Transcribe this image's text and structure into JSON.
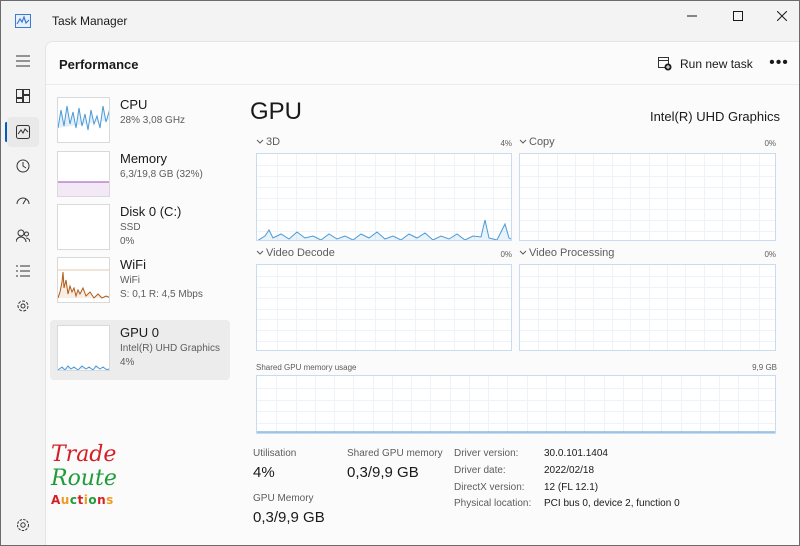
{
  "window": {
    "title": "Task Manager"
  },
  "header": {
    "title": "Performance",
    "run_task_label": "Run new task",
    "more_label": "•••"
  },
  "sidebar": [
    {
      "name": "CPU",
      "sub1": "28%  3,08 GHz",
      "sub2": ""
    },
    {
      "name": "Memory",
      "sub1": "6,3/19,8 GB (32%)",
      "sub2": ""
    },
    {
      "name": "Disk 0 (C:)",
      "sub1": "SSD",
      "sub2": "0%"
    },
    {
      "name": "WiFi",
      "sub1": "WiFi",
      "sub2": "S: 0,1  R: 4,5 Mbps"
    },
    {
      "name": "GPU 0",
      "sub1": "Intel(R) UHD Graphics",
      "sub2": "4%"
    }
  ],
  "gpu": {
    "title": "GPU",
    "model": "Intel(R) UHD Graphics",
    "engines": [
      {
        "name": "3D",
        "pct": "4%"
      },
      {
        "name": "Copy",
        "pct": "0%"
      },
      {
        "name": "Video Decode",
        "pct": "0%"
      },
      {
        "name": "Video Processing",
        "pct": "0%"
      }
    ],
    "shared_label": "Shared GPU memory usage",
    "shared_max": "9,9 GB",
    "stats": {
      "utilisation_label": "Utilisation",
      "utilisation_value": "4%",
      "shared_mem_label": "Shared GPU memory",
      "shared_mem_value": "0,3/9,9 GB",
      "gpu_mem_label": "GPU Memory",
      "gpu_mem_value": "0,3/9,9 GB"
    },
    "info": [
      {
        "key": "Driver version:",
        "value": "30.0.101.1404"
      },
      {
        "key": "Driver date:",
        "value": "2022/02/18"
      },
      {
        "key": "DirectX version:",
        "value": "12 (FL 12.1)"
      },
      {
        "key": "Physical location:",
        "value": "PCI bus 0, device 2, function 0"
      }
    ]
  },
  "logo": {
    "line1": "Trade",
    "line2": "Route",
    "line3": [
      "A",
      "u",
      "c",
      "t",
      "i",
      "o",
      "n",
      "s"
    ],
    "line3_colors": [
      "#d41f26",
      "#f29a1d",
      "#1e9c3a",
      "#d41f26",
      "#f29a1d",
      "#1e9c3a",
      "#d41f26",
      "#f29a1d"
    ]
  },
  "colors": {
    "accent": "#005fb8",
    "gpu_line": "#4c9ad6",
    "memory_line": "#9a4db5",
    "wifi_line": "#b05a14"
  },
  "icons": [
    "hamburger-icon",
    "processes-icon",
    "performance-icon",
    "history-icon",
    "startup-icon",
    "users-icon",
    "details-icon",
    "services-icon",
    "settings-icon"
  ]
}
